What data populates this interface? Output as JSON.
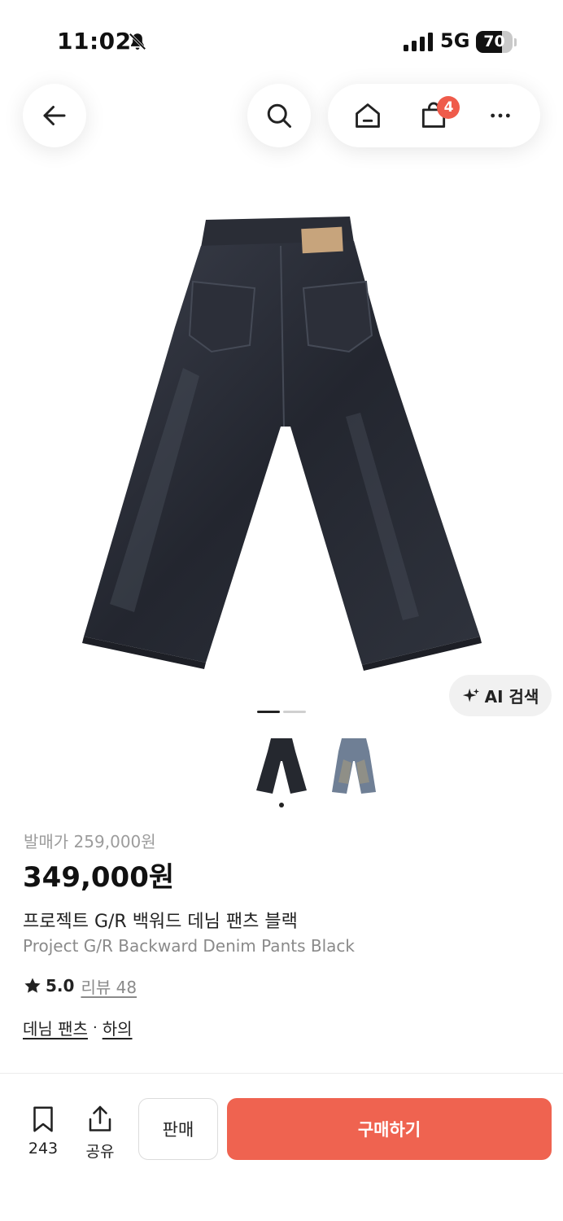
{
  "status_bar": {
    "time": "11:02",
    "network": "5G",
    "battery": "70",
    "battery_level": 0.7
  },
  "nav": {
    "cart_count": "4"
  },
  "ai_search": {
    "label": "AI 검색"
  },
  "gallery": {
    "page_count": 2,
    "current_page": 1
  },
  "product": {
    "release_price": "발매가 259,000원",
    "price": "349,000원",
    "title_ko": "프로젝트 G/R 백워드 데님 팬츠 블랙",
    "title_en": "Project G/R Backward Denim Pants Black",
    "rating": "5.0",
    "review_label": "리뷰 48",
    "categories": [
      "데님 팬츠",
      "하의"
    ],
    "category_separator": "·"
  },
  "bottom_bar": {
    "bookmark_count": "243",
    "share_label": "공유",
    "sell_label": "판매",
    "buy_label": "구매하기"
  },
  "colors": {
    "accent": "#ef6350",
    "badge": "#ef5b4b"
  }
}
